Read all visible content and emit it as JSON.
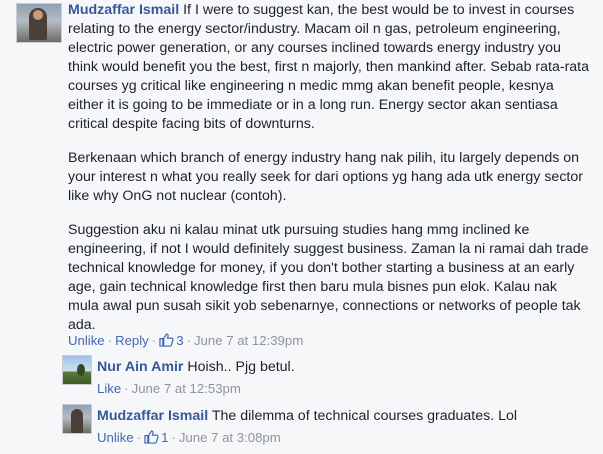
{
  "comments": [
    {
      "author": "Mudzaffar Ismail",
      "text": " If I were to suggest kan, the best would be to invest in courses relating to the energy sector/industry. Macam oil n gas, petroleum engineering, electric power generation, or any courses inclined towards energy industry you think would benefit you the best, first n majorly, then mankind after. Sebab rata-rata courses yg critical like engineering n medic mmg akan benefit people, kesnya either it is going to be immediate or in a long run. Energy sector akan sentiasa critical despite facing bits of downturns.",
      "para2": "Berkenaan which branch of energy industry hang nak pilih, itu largely depends on your interest n what you really seek for dari options yg hang ada utk energy sector like why OnG not nuclear (contoh).",
      "para3": "Suggestion aku ni kalau minat utk pursuing studies hang mmg inclined ke engineering, if not I would definitely suggest business. Zaman la ni ramai dah trade technical knowledge for money, if you don't bother starting a business at an early age, gain technical knowledge first then baru mula bisnes pun elok. Kalau nak mula awal pun susah sikit yob sebenarnye, connections or networks of people tak ada.",
      "unlike": "Unlike",
      "reply": "Reply",
      "likes": "3",
      "time": "June 7 at 12:39pm"
    },
    {
      "author": "Nur Ain Amir",
      "text": " Hoish.. Pjg betul.",
      "like": "Like",
      "time": "June 7 at 12:53pm"
    },
    {
      "author": "Mudzaffar Ismail",
      "text": " The dilemma of technical courses graduates. Lol",
      "unlike": "Unlike",
      "likes": "1",
      "time": "June 7 at 3:08pm"
    }
  ],
  "separator": "·"
}
